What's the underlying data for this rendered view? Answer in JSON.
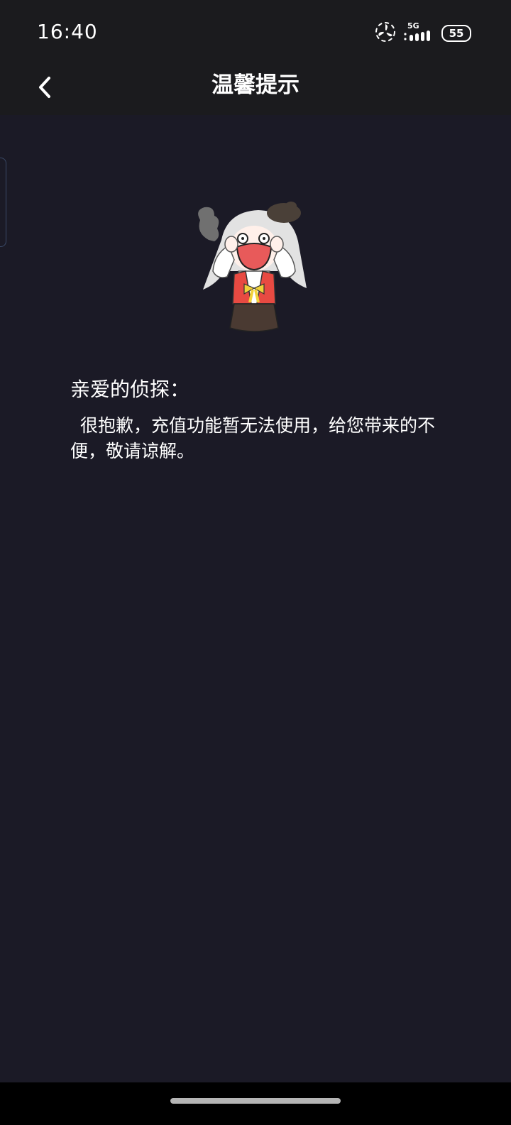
{
  "status_bar": {
    "time": "16:40",
    "network": "5G",
    "battery": "55",
    "icons": [
      "fan-icon",
      "signal-icon",
      "battery-icon"
    ]
  },
  "header": {
    "title": "温馨提示",
    "back_icon": "chevron-left-icon"
  },
  "notice": {
    "mascot": "crying-girl-mascot",
    "greeting": "亲爱的侦探：",
    "message": "很抱歉，充值功能暂无法使用，给您带来的不便，敬请谅解。"
  },
  "colors": {
    "background": "#1b1a26",
    "bar": "#1b1b1e",
    "text": "#ffffff"
  }
}
